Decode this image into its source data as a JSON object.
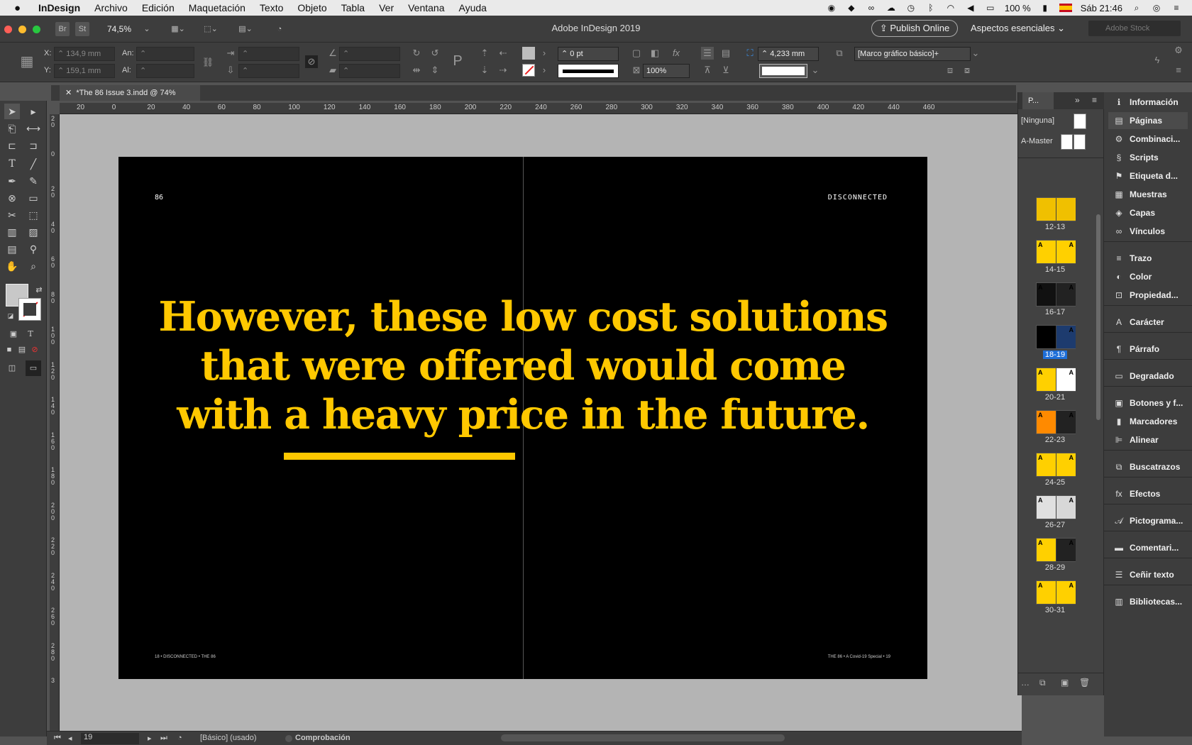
{
  "menubar": {
    "apple": "",
    "items": [
      "InDesign",
      "Archivo",
      "Edición",
      "Maquetación",
      "Texto",
      "Objeto",
      "Tabla",
      "Ver",
      "Ventana",
      "Ayuda"
    ],
    "battery": "100 %",
    "clock": "Sáb 21:46"
  },
  "appbar": {
    "br": "Br",
    "st": "St",
    "zoom": "74,5%",
    "title": "Adobe InDesign 2019",
    "publish": "Publish Online",
    "workspace": "Aspectos esenciales",
    "stock_placeholder": "Adobe Stock"
  },
  "control": {
    "x_label": "X:",
    "x_value": "134,9 mm",
    "y_label": "Y:",
    "y_value": "159,1 mm",
    "w_label": "An:",
    "h_label": "Al:",
    "stroke_weight": "0 pt",
    "opacity": "100%",
    "offset": "4,233 mm",
    "object_style": "[Marco gráfico básico]+"
  },
  "document": {
    "tab_label": "*The 86 Issue 3.indd @ 74%",
    "ruler_h": [
      "20",
      "0",
      "20",
      "40",
      "60",
      "80",
      "100",
      "120",
      "140",
      "160",
      "180",
      "200",
      "220",
      "240",
      "260",
      "280",
      "300",
      "320",
      "340",
      "360",
      "380",
      "400",
      "420",
      "440",
      "460"
    ],
    "ruler_v": [
      "2\n0",
      "0",
      "2\n0",
      "4\n0",
      "6\n0",
      "8\n0",
      "1\n0\n0",
      "1\n2\n0",
      "1\n4\n0",
      "1\n6\n0",
      "1\n8\n0",
      "2\n0\n0",
      "2\n2\n0",
      "2\n4\n0",
      "2\n6\n0",
      "2\n8\n0",
      "3"
    ],
    "folio_left": "86",
    "folio_right": "DISCONNECTED",
    "quote": "However, these low cost solutions that were offered would come with a heavy price in the future.",
    "footer_left": "18 • DISCONNECTED • THE 86",
    "footer_right": "THE 86 • A Covid-19 Special • 19",
    "accent": "#ffc800"
  },
  "status": {
    "page": "19",
    "master": "[Básico] (usado)",
    "preflight": "Comprobación"
  },
  "pages_panel": {
    "tab": "P...",
    "masters": [
      {
        "label": "[Ninguna]"
      },
      {
        "label": "A-Master"
      }
    ],
    "spreads": [
      {
        "label": "12-13",
        "left": "#f0c000",
        "right": "#f0c000"
      },
      {
        "label": "14-15",
        "left": "#ffd000",
        "right": "#ffd000"
      },
      {
        "label": "16-17",
        "left": "#111111",
        "right": "#222222"
      },
      {
        "label": "18-19",
        "left": "#000000",
        "right": "#1d3b6e"
      },
      {
        "label": "20-21",
        "left": "#ffd000",
        "right": "#ffffff"
      },
      {
        "label": "22-23",
        "left": "#ff8a00",
        "right": "#222222"
      },
      {
        "label": "24-25",
        "left": "#ffd000",
        "right": "#ffd000"
      },
      {
        "label": "26-27",
        "left": "#e0e0e0",
        "right": "#d8d8d8"
      },
      {
        "label": "28-29",
        "left": "#ffd000",
        "right": "#222222"
      },
      {
        "label": "30-31",
        "left": "#ffd000",
        "right": "#ffd000"
      }
    ],
    "selected": "18-19"
  },
  "dock": {
    "items": [
      {
        "label": "Información",
        "icon": "info-icon",
        "glyph": "ℹ"
      },
      {
        "label": "Páginas",
        "icon": "pages-icon",
        "glyph": "▤"
      },
      {
        "label": "Combinaci...",
        "icon": "merge-icon",
        "glyph": "⚙"
      },
      {
        "label": "Scripts",
        "icon": "scripts-icon",
        "glyph": "§"
      },
      {
        "label": "Etiqueta d...",
        "icon": "tags-icon",
        "glyph": "⚑"
      },
      {
        "label": "Muestras",
        "icon": "swatches-icon",
        "glyph": "▦"
      },
      {
        "label": "Capas",
        "icon": "layers-icon",
        "glyph": "◈"
      },
      {
        "label": "Vínculos",
        "icon": "links-icon",
        "glyph": "∞"
      },
      {
        "label": "Trazo",
        "icon": "stroke-icon",
        "glyph": "≡"
      },
      {
        "label": "Color",
        "icon": "color-icon",
        "glyph": "◐"
      },
      {
        "label": "Propiedad...",
        "icon": "properties-icon",
        "glyph": "⊡"
      },
      {
        "label": "Carácter",
        "icon": "character-icon",
        "glyph": "A"
      },
      {
        "label": "Párrafo",
        "icon": "paragraph-icon",
        "glyph": "¶"
      },
      {
        "label": "Degradado",
        "icon": "gradient-icon",
        "glyph": "▭"
      },
      {
        "label": "Botones y f...",
        "icon": "buttons-icon",
        "glyph": "▣"
      },
      {
        "label": "Marcadores",
        "icon": "bookmarks-icon",
        "glyph": "▮"
      },
      {
        "label": "Alinear",
        "icon": "align-icon",
        "glyph": "⊫"
      },
      {
        "label": "Buscatrazos",
        "icon": "pathfinder-icon",
        "glyph": "⧉"
      },
      {
        "label": "Efectos",
        "icon": "effects-icon",
        "glyph": "fx"
      },
      {
        "label": "Pictograma...",
        "icon": "glyphs-icon",
        "glyph": "𝒜"
      },
      {
        "label": "Comentari...",
        "icon": "comments-icon",
        "glyph": "▬"
      },
      {
        "label": "Ceñir texto",
        "icon": "text-wrap-icon",
        "glyph": "☰"
      },
      {
        "label": "Bibliotecas...",
        "icon": "libraries-icon",
        "glyph": "▥"
      }
    ]
  }
}
